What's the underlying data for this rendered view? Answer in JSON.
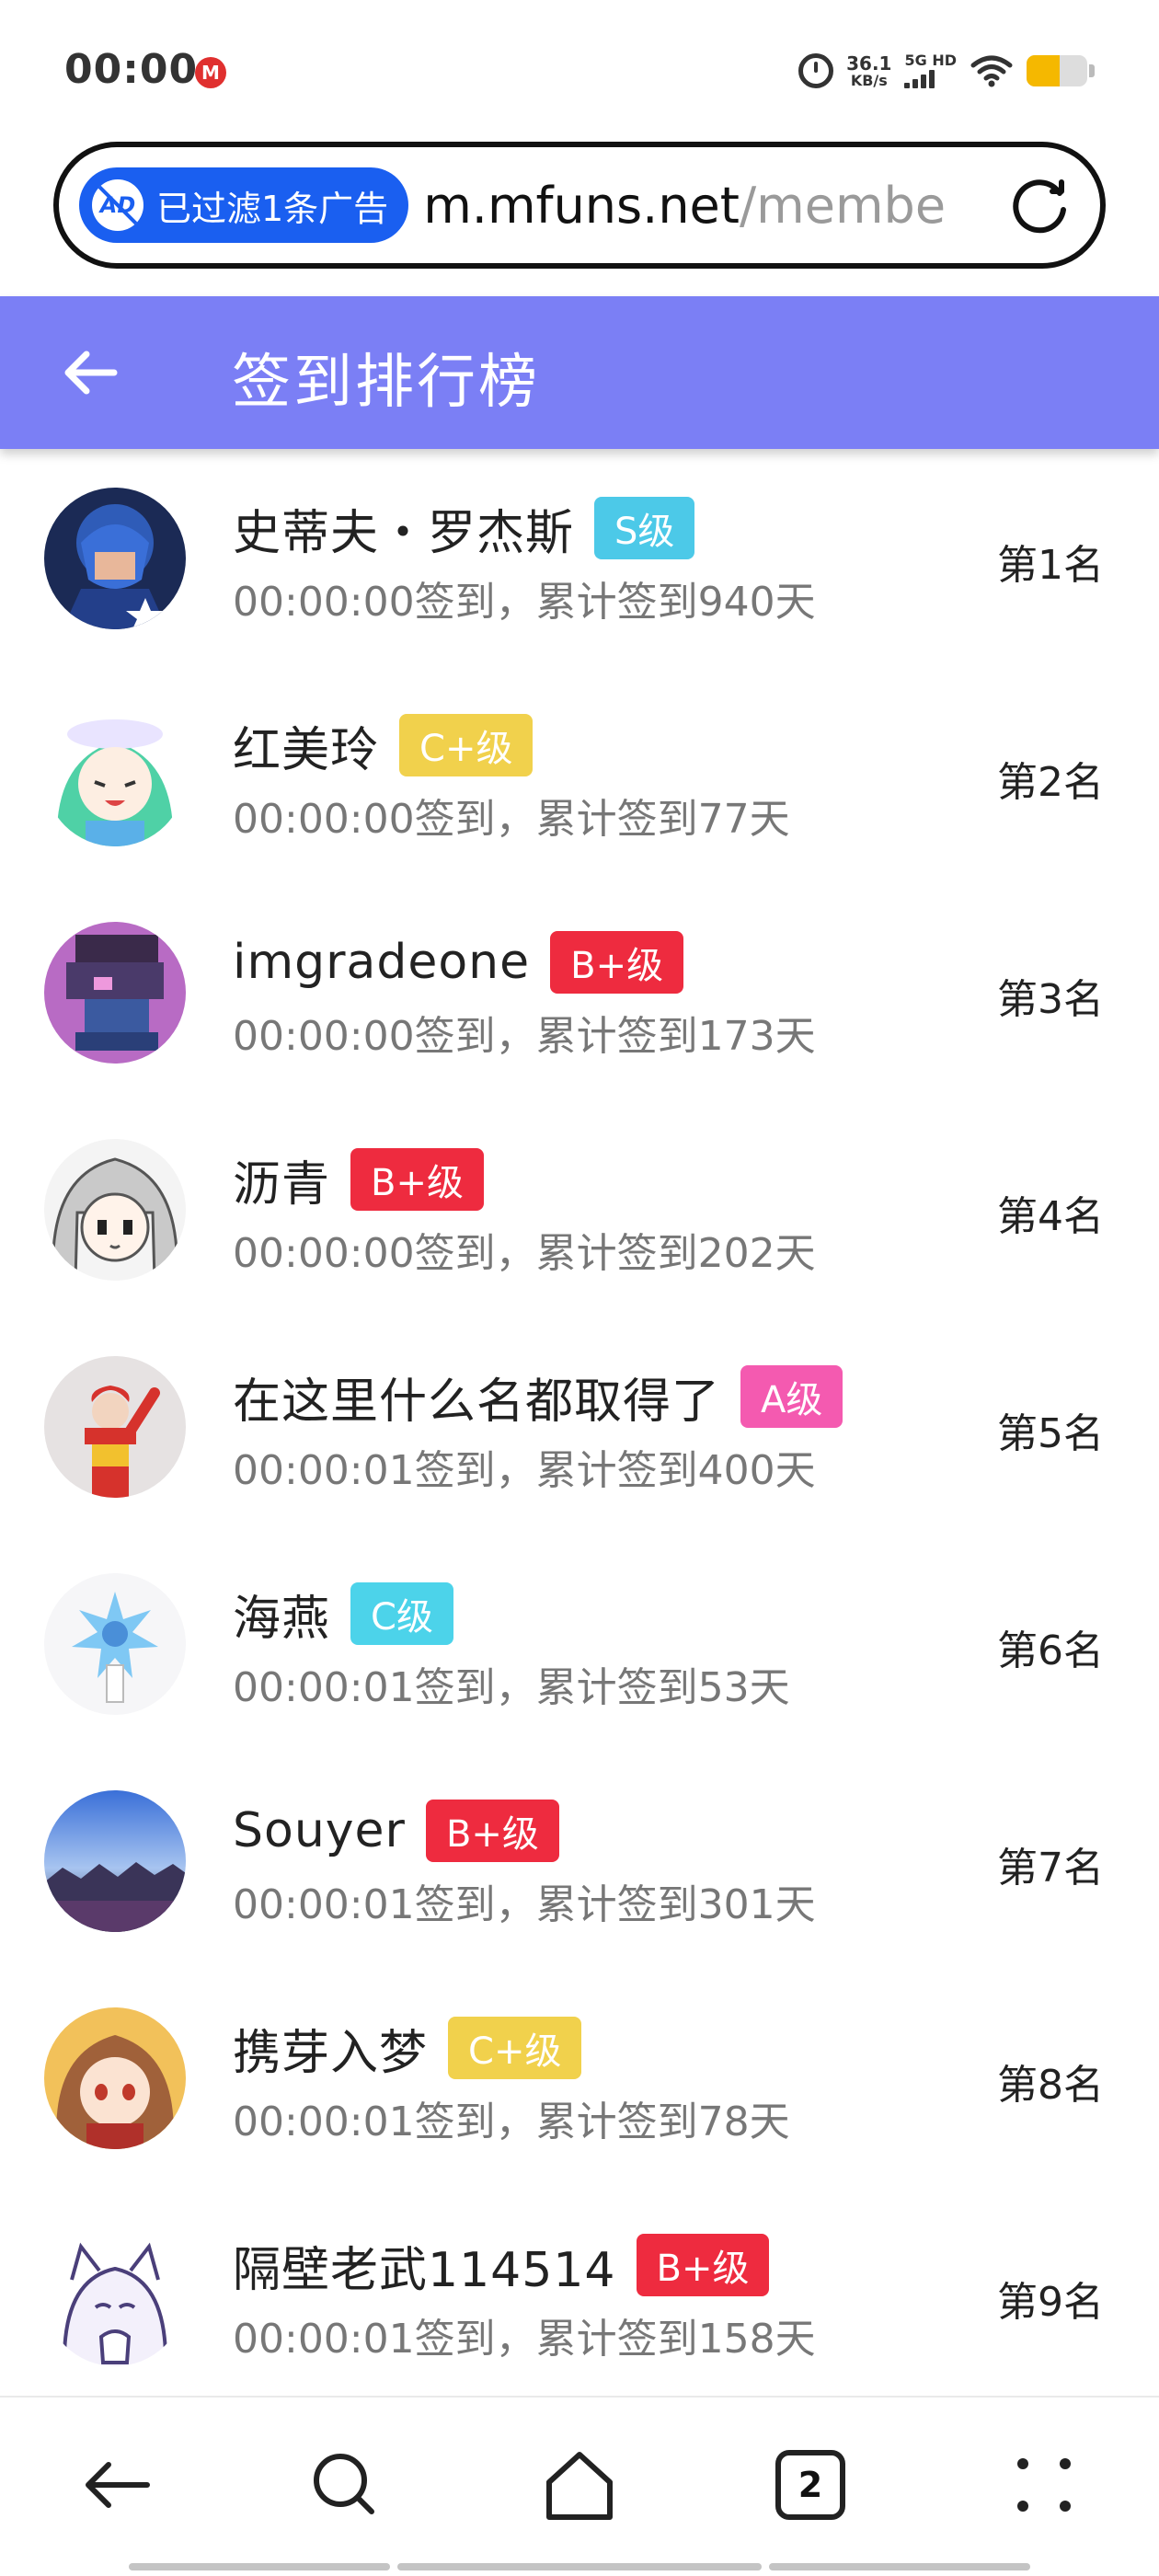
{
  "status_bar": {
    "time": "00:00",
    "app_icon_glyph": "M",
    "net_speed_value": "36.1",
    "net_speed_unit": "KB/s",
    "network_label": "5G HD",
    "battery_level": 0.55,
    "battery_color": "#f5b800"
  },
  "browser": {
    "ad_filter_label": "已过滤1条广告",
    "ad_icon_text": "AD",
    "url_host": "m.mfuns.net",
    "url_path": "/membe"
  },
  "header": {
    "title": "签到排行榜",
    "background_color": "#7b7ff5"
  },
  "rankings": [
    {
      "name": "史蒂夫・罗杰斯",
      "level": "S级",
      "level_color": "#4cc9e8",
      "checkin": "00:00:00签到，累计签到940天",
      "rank": "第1名"
    },
    {
      "name": "红美玲",
      "level": "C+级",
      "level_color": "#f1d14c",
      "checkin": "00:00:00签到，累计签到77天",
      "rank": "第2名"
    },
    {
      "name": "imgradeone",
      "level": "B+级",
      "level_color": "#ee2b3f",
      "checkin": "00:00:00签到，累计签到173天",
      "rank": "第3名"
    },
    {
      "name": "沥青",
      "level": "B+级",
      "level_color": "#ee2b3f",
      "checkin": "00:00:00签到，累计签到202天",
      "rank": "第4名"
    },
    {
      "name": "在这里什么名都取得了",
      "level": "A级",
      "level_color": "#f45ab0",
      "checkin": "00:00:01签到，累计签到400天",
      "rank": "第5名"
    },
    {
      "name": "海燕",
      "level": "C级",
      "level_color": "#4cd3ea",
      "checkin": "00:00:01签到，累计签到53天",
      "rank": "第6名"
    },
    {
      "name": "Souyer",
      "level": "B+级",
      "level_color": "#ee2b3f",
      "checkin": "00:00:01签到，累计签到301天",
      "rank": "第7名"
    },
    {
      "name": "携芽入梦",
      "level": "C+级",
      "level_color": "#f1d14c",
      "checkin": "00:00:01签到，累计签到78天",
      "rank": "第8名"
    },
    {
      "name": "隔壁老武114514",
      "level": "B+级",
      "level_color": "#ee2b3f",
      "checkin": "00:00:01签到，累计签到158天",
      "rank": "第9名"
    }
  ],
  "bottom_nav": {
    "tab_count": "2",
    "icons": [
      "back-icon",
      "search-icon",
      "home-icon",
      "tabs-icon",
      "menu-icon"
    ]
  }
}
